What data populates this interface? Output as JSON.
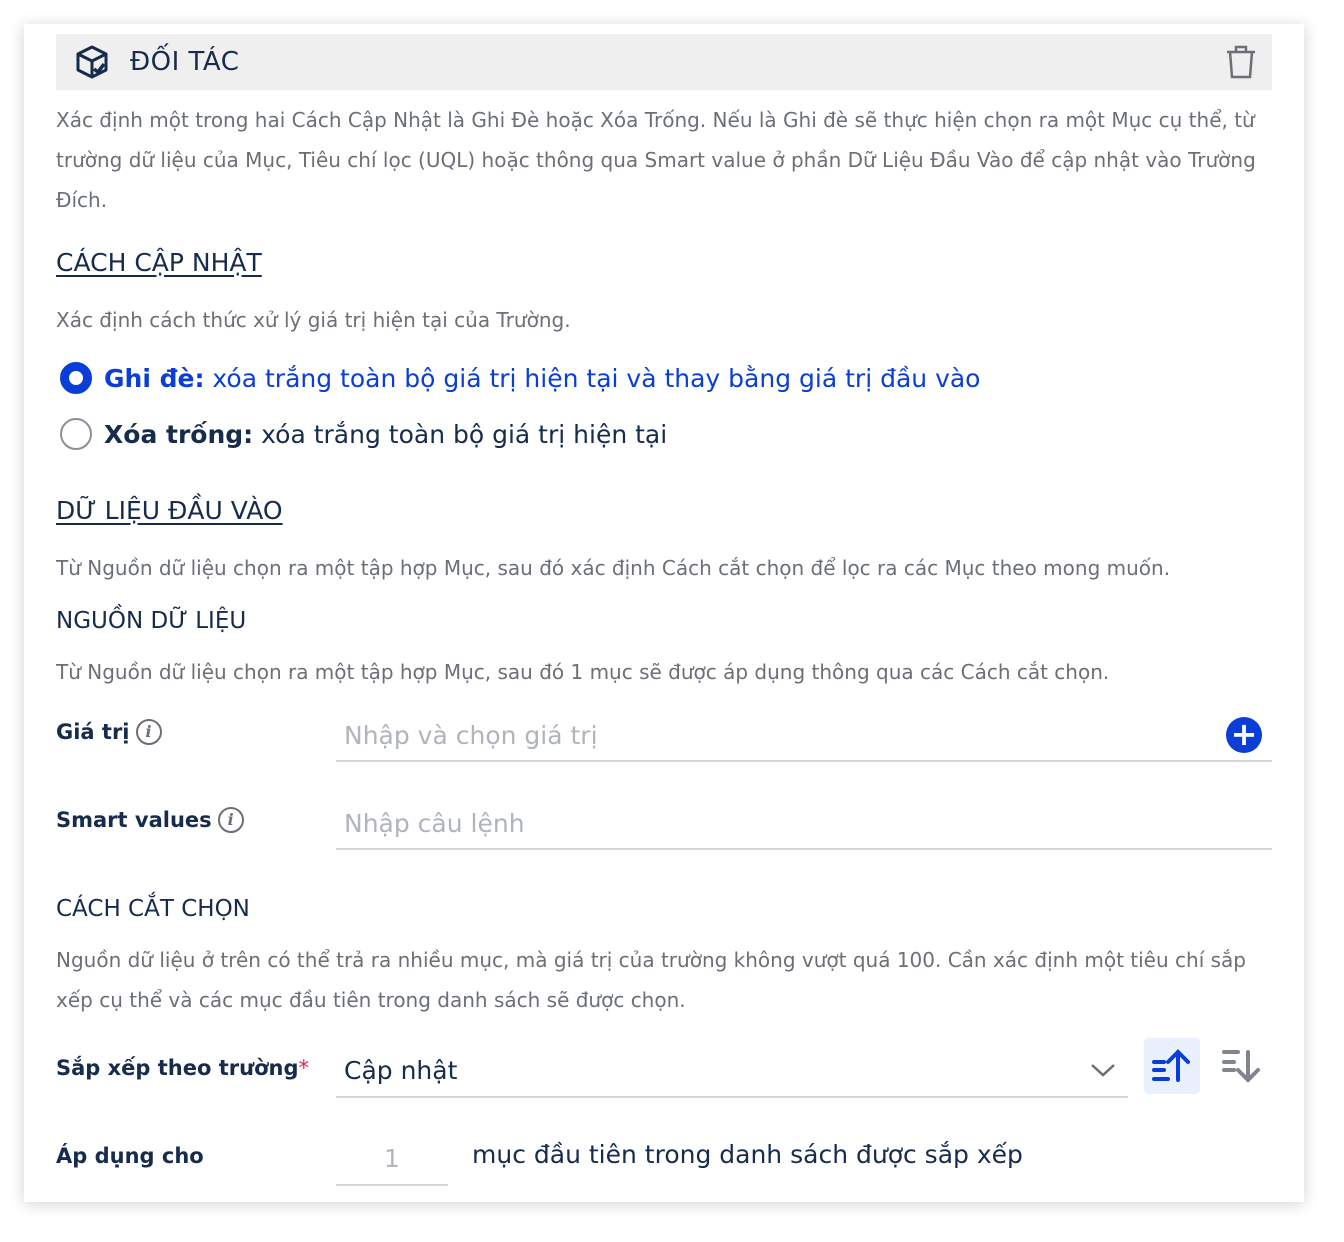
{
  "header": {
    "title": "ĐỐI TÁC",
    "icon": "box-check-icon",
    "delete_icon": "trash-icon"
  },
  "intro": "Xác định một trong hai Cách Cập Nhật là Ghi Đè hoặc Xóa Trống. Nếu là Ghi đè sẽ thực hiện chọn ra một Mục cụ thể, từ trường dữ liệu của Mục, Tiêu chí lọc (UQL) hoặc thông qua Smart value ở phần Dữ Liệu Đầu Vào để cập nhật vào Trường Đích.",
  "update": {
    "title": "CÁCH CẬP NHẬT",
    "desc": "Xác định cách thức xử lý giá trị hiện tại của Trường.",
    "options": [
      {
        "label": "Ghi đè:",
        "text": "xóa trắng toàn bộ giá trị hiện tại và thay bằng giá trị đầu vào",
        "selected": true
      },
      {
        "label": "Xóa trống:",
        "text": "xóa trắng toàn bộ giá trị hiện tại",
        "selected": false
      }
    ]
  },
  "input": {
    "title": "DỮ LIỆU ĐẦU VÀO",
    "desc": "Từ Nguồn dữ liệu chọn ra một tập hợp Mục, sau đó xác định Cách cắt chọn để lọc ra các Mục theo mong muốn.",
    "source_title": "NGUỒN DỮ LIỆU",
    "source_desc": "Từ Nguồn dữ liệu chọn ra một tập hợp Mục, sau đó 1 mục sẽ được áp dụng thông qua các Cách cắt chọn.",
    "value_label": "Giá trị",
    "value_placeholder": "Nhập và chọn giá trị",
    "smart_label": "Smart values",
    "smart_placeholder": "Nhập câu lệnh"
  },
  "slice": {
    "title": "CÁCH CẮT CHỌN",
    "desc": "Nguồn dữ liệu ở trên có thể trả ra nhiều mục, mà giá trị của trường không vượt quá 100. Cần xác định một tiêu chí sắp xếp cụ thể và các mục đầu tiên trong danh sách sẽ được chọn.",
    "sort_label": "Sắp xếp theo trường",
    "required": "*",
    "sort_value": "Cập nhật",
    "sort_direction": "ascending",
    "apply_label": "Áp dụng cho",
    "apply_value": "1",
    "apply_suffix": "mục đầu tiên trong danh sách được sắp xếp"
  },
  "colors": {
    "accent": "#0b3ed6",
    "text": "#172b4d",
    "muted": "#6b6f76"
  }
}
